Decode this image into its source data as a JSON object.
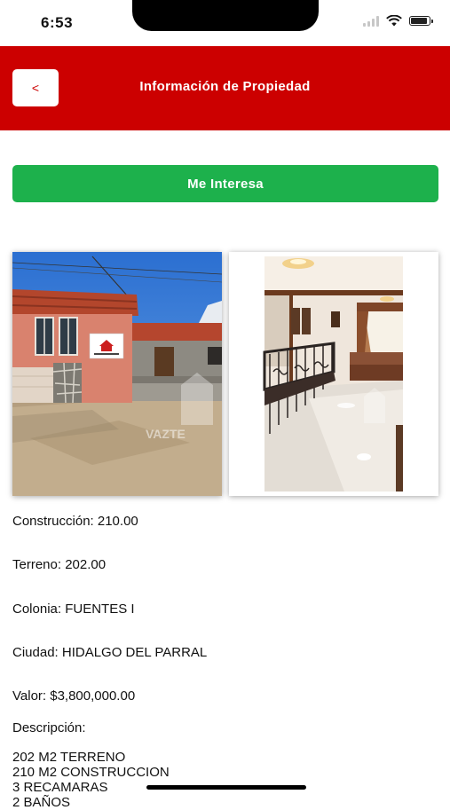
{
  "status": {
    "time": "6:53"
  },
  "header": {
    "back_label": "<",
    "title": "Información de Propiedad"
  },
  "actions": {
    "interest_label": "Me Interesa"
  },
  "photos": {
    "watermark": "VAZTE"
  },
  "details": {
    "construction": "Construcción: 210.00",
    "land": "Terreno: 202.00",
    "neighborhood": "Colonia: FUENTES I",
    "city": "Ciudad: HIDALGO DEL PARRAL",
    "price": "Valor: $3,800,000.00",
    "description_label": "Descripción:",
    "description_lines": [
      "202 M2 TERRENO",
      "210 M2 CONSTRUCCION",
      "3 RECAMARAS",
      "2 BAÑOS"
    ]
  },
  "colors": {
    "header": "#cc0000",
    "interest_button": "#1db14c"
  }
}
